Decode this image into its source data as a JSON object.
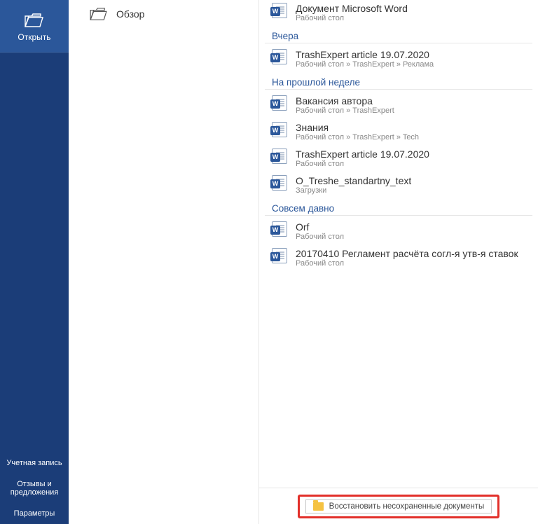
{
  "sidebar": {
    "selected_label": "Открыть",
    "bottom": {
      "account": "Учетная запись",
      "feedback": "Отзывы и предложения",
      "options": "Параметры"
    }
  },
  "mid": {
    "overview_label": "Обзор"
  },
  "groups": [
    {
      "header": "",
      "items": [
        {
          "title": "Документ Microsoft Word",
          "sub": "Рабочий стол"
        }
      ]
    },
    {
      "header": "Вчера",
      "items": [
        {
          "title": "TrashExpert article 19.07.2020",
          "sub": "Рабочий стол » TrashExpert » Реклама"
        }
      ]
    },
    {
      "header": "На прошлой неделе",
      "items": [
        {
          "title": "Вакансия автора",
          "sub": "Рабочий стол » TrashExpert"
        },
        {
          "title": "Знания",
          "sub": "Рабочий стол » TrashExpert » Tech"
        },
        {
          "title": "TrashExpert article 19.07.2020",
          "sub": "Рабочий стол"
        },
        {
          "title": "O_Treshe_standartny_text",
          "sub": "Загрузки"
        }
      ]
    },
    {
      "header": "Совсем давно",
      "items": [
        {
          "title": "Orf",
          "sub": "Рабочий стол"
        },
        {
          "title": "20170410 Регламент расчёта согл-я утв-я ставок",
          "sub": "Рабочий стол"
        }
      ]
    }
  ],
  "recover": {
    "label": "Восстановить несохраненные документы"
  }
}
